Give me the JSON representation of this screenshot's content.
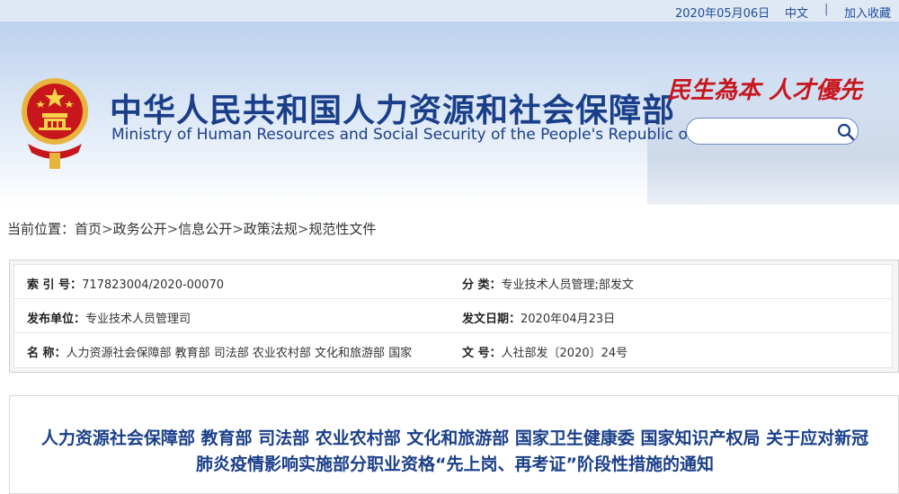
{
  "topbar": {
    "date": "2020年05月06日",
    "lang": "中文",
    "separator": "|",
    "favorite": "加入收藏"
  },
  "header": {
    "title_cn": "中华人民共和国人力资源和社会保障部",
    "title_en": "Ministry of Human Resources and Social Security of the People's Republic of China",
    "slogan": "民生為本  人才優先",
    "search": {
      "placeholder": "",
      "icon": "search-icon"
    }
  },
  "breadcrumb": {
    "prefix": "当前位置：",
    "items": [
      "首页",
      "政务公开",
      "信息公开",
      "政策法规",
      "规范性文件"
    ],
    "sep": ">"
  },
  "meta": {
    "index_key": "索 引 号：",
    "index_val": "717823004/2020-00070",
    "category_key": "分    类：",
    "category_val": "专业技术人员管理;部发文",
    "publisher_key": "发布单位：",
    "publisher_val": "专业技术人员管理司",
    "date_key": "发文日期：",
    "date_val": "2020年04月23日",
    "name_key": "名    称：",
    "name_val": "人力资源社会保障部 教育部 司法部 农业农村部 文化和旅游部 国家",
    "docno_key": "文    号：",
    "docno_val": "人社部发〔2020〕24号"
  },
  "document": {
    "title": "人力资源社会保障部 教育部 司法部 农业农村部 文化和旅游部 国家卫生健康委 国家知识产权局 关于应对新冠肺炎疫情影响实施部分职业资格“先上岗、再考证”阶段性措施的通知"
  },
  "colors": {
    "brand_blue": "#1a3f8a",
    "slogan_red": "#c8161d",
    "emblem_red": "#c8161d",
    "emblem_gold": "#e8b53c"
  }
}
